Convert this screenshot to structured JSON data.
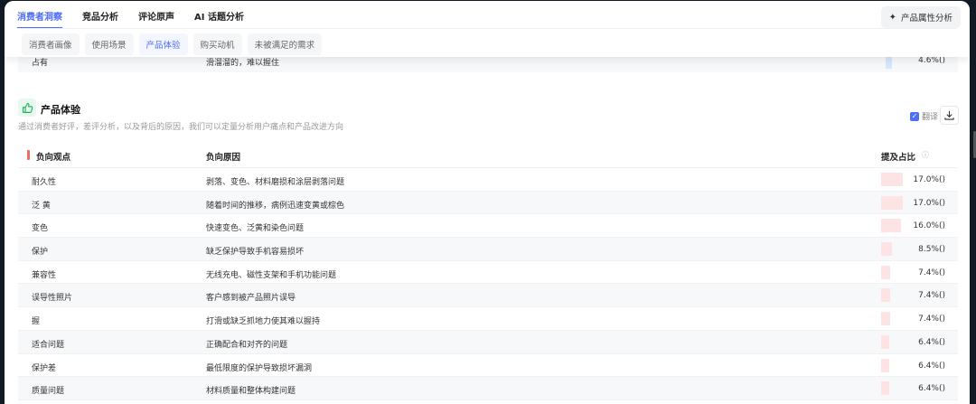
{
  "nav": {
    "tabs": [
      "消费者洞察",
      "竞品分析",
      "评论原声",
      "AI 话题分析"
    ],
    "active_tab": 0,
    "subtabs": [
      "消费者画像",
      "使用场景",
      "产品体验",
      "购买动机",
      "未被满足的需求"
    ],
    "active_subtab": 2,
    "attr_button": "产品属性分析"
  },
  "prev_row": {
    "point": "占有",
    "reason": "滑溜溜的，难以握住",
    "pct": "4.6%()",
    "value": 4.6
  },
  "section": {
    "title": "产品体验",
    "desc": "通过消费者好评，差评分析，以及背后的原因，我们可以定量分析用户痛点和产品改进方向",
    "translate": "翻译"
  },
  "table": {
    "headers": [
      "负向观点",
      "负向原因",
      "提及占比"
    ],
    "rows": [
      {
        "point": "耐久性",
        "reason": "剥落、变色、材料磨损和涂层剥落问题",
        "pct": "17.0%()",
        "value": 17.0
      },
      {
        "point": "泛 黄",
        "reason": "随着时间的推移，病例迅速变黄或棕色",
        "pct": "17.0%()",
        "value": 17.0
      },
      {
        "point": "变色",
        "reason": "快速变色、泛黄和染色问题",
        "pct": "16.0%()",
        "value": 16.0
      },
      {
        "point": "保护",
        "reason": "缺乏保护导致手机容易损坏",
        "pct": "8.5%()",
        "value": 8.5
      },
      {
        "point": "兼容性",
        "reason": "无线充电、磁性支架和手机功能问题",
        "pct": "7.4%()",
        "value": 7.4
      },
      {
        "point": "误导性照片",
        "reason": "客户感到被产品照片误导",
        "pct": "7.4%()",
        "value": 7.4
      },
      {
        "point": "握",
        "reason": "打滑或缺乏抓地力使其难以握持",
        "pct": "7.4%()",
        "value": 7.4
      },
      {
        "point": "适合问题",
        "reason": "正确配合和对齐的问题",
        "pct": "6.4%()",
        "value": 6.4
      },
      {
        "point": "保护差",
        "reason": "最低限度的保护导致损坏漏洞",
        "pct": "6.4%()",
        "value": 6.4
      },
      {
        "point": "质量问题",
        "reason": "材料质量和整体构建问题",
        "pct": "6.4%()",
        "value": 6.4
      }
    ]
  }
}
